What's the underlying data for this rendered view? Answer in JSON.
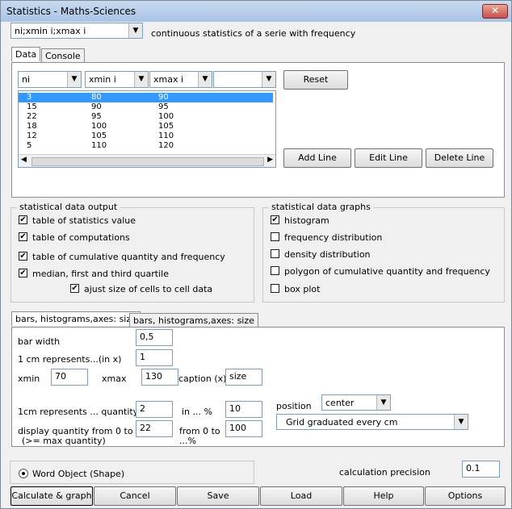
{
  "window": {
    "title": "Statistics - Maths-Sciences"
  },
  "topbar": {
    "mode_value": "ni;xmin i;xmax i",
    "description": "continuous statistics of a serie with frequency"
  },
  "tabs": [
    "Data",
    "Console"
  ],
  "data": {
    "columns": [
      "ni",
      "xmin i",
      "xmax i",
      ""
    ],
    "rows": [
      [
        "3",
        "80",
        "90"
      ],
      [
        "15",
        "90",
        "95"
      ],
      [
        "22",
        "95",
        "100"
      ],
      [
        "18",
        "100",
        "105"
      ],
      [
        "12",
        "105",
        "110"
      ],
      [
        "5",
        "110",
        "120"
      ]
    ],
    "buttons": {
      "reset": "Reset",
      "add": "Add Line",
      "edit": "Edit Line",
      "delete": "Delete Line"
    }
  },
  "output": {
    "title": "statistical data output",
    "items": [
      {
        "label": "table of statistics value",
        "checked": true
      },
      {
        "label": "table of computations",
        "checked": true
      },
      {
        "label": "table of cumulative quantity and frequency",
        "checked": true
      },
      {
        "label": "median, first and third quartile",
        "checked": true
      },
      {
        "label": "ajust size of cells to cell data",
        "checked": true
      }
    ]
  },
  "graphs": {
    "title": "statistical data graphs",
    "items": [
      {
        "label": "histogram",
        "checked": true
      },
      {
        "label": "frequency distribution",
        "checked": false
      },
      {
        "label": "density distribution",
        "checked": false
      },
      {
        "label": "polygon of cumulative quantity and frequency",
        "checked": false
      },
      {
        "label": "box plot",
        "checked": false
      }
    ]
  },
  "bars": {
    "tabs": [
      "bars, histograms,axes: size",
      "bars, histograms,axes: size"
    ],
    "bar_width_label": "bar width",
    "bar_width": "0,5",
    "cm_x_label": "1 cm represents...(in x)",
    "cm_x": "1",
    "xmin_label": "xmin",
    "xmin": "70",
    "xmax_label": "xmax",
    "xmax": "130",
    "caption_label": "caption (x)",
    "caption": "size",
    "cm_q_label": "1cm represents ... quantity",
    "cm_q": "2",
    "in_pct_label": "in ... %",
    "in_pct": "10",
    "display_label": "display quantity from 0 to ...",
    "display_sub": "(>= max quantity)",
    "display": "22",
    "from0_label": "from 0 to",
    "from0_sub": "...%",
    "from0": "100",
    "position_label": "position",
    "position": "center",
    "grid": "Grid graduated every cm"
  },
  "bottom": {
    "word_object": "Word Object (Shape)",
    "precision_label": "calculation precision",
    "precision": "0.1",
    "buttons": [
      "Calculate & graph",
      "Cancel",
      "Save",
      "Load",
      "Help",
      "Options"
    ]
  }
}
